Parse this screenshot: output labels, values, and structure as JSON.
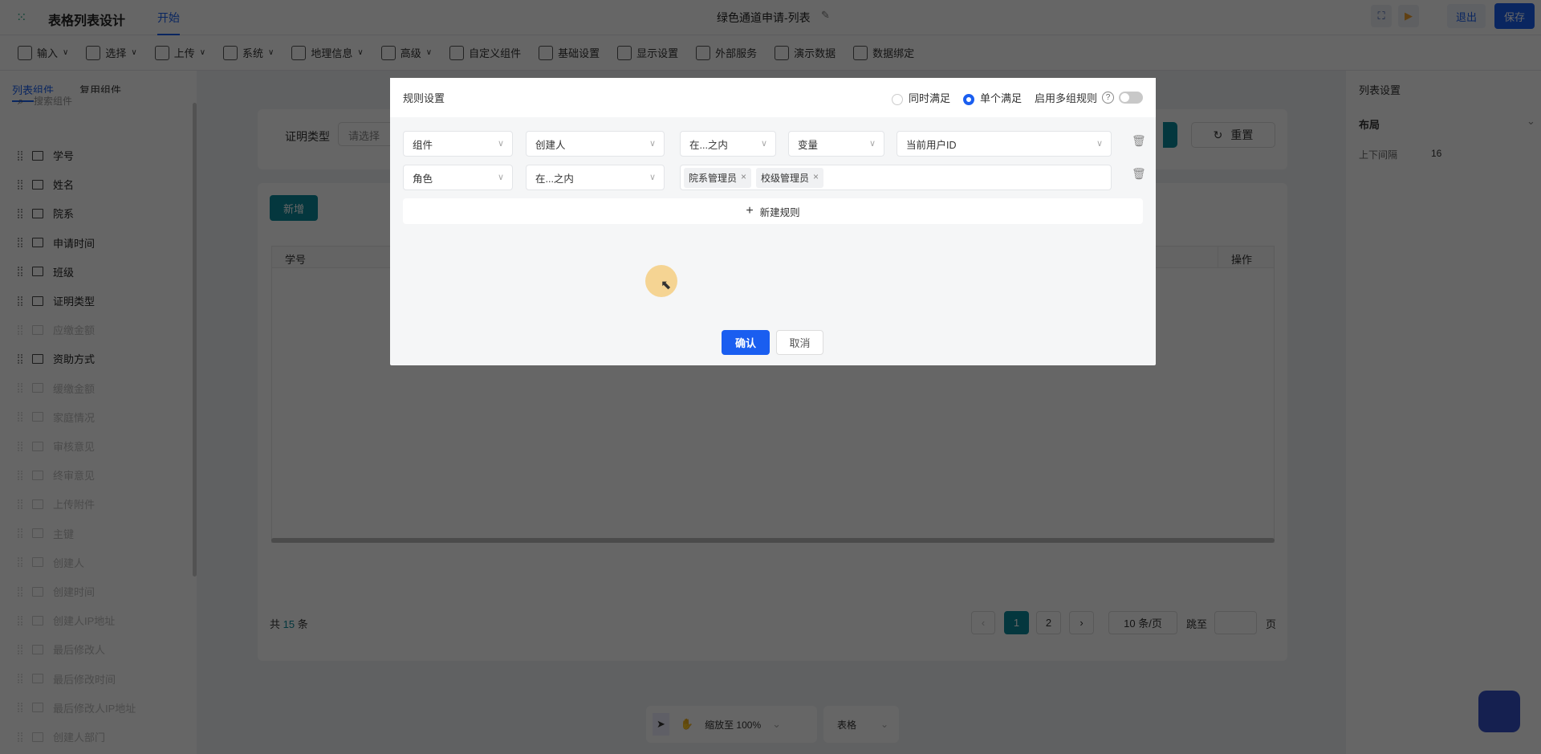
{
  "app": {
    "title": "表格列表设计",
    "tab": "开始",
    "doc_title": "绿色通道申请-列表",
    "exit": "退出",
    "save": "保存"
  },
  "toolbar": [
    "输入",
    "选择",
    "上传",
    "系统",
    "地理信息",
    "高级",
    "自定义组件",
    "基础设置",
    "显示设置",
    "外部服务",
    "演示数据",
    "数据绑定"
  ],
  "toolbar_dropdown": [
    true,
    true,
    true,
    true,
    true,
    true,
    false,
    false,
    false,
    false,
    false,
    false
  ],
  "left": {
    "tabs": [
      "列表组件",
      "复用组件"
    ],
    "search_placeholder": "搜索组件",
    "items": [
      {
        "label": "学号",
        "enabled": true
      },
      {
        "label": "姓名",
        "enabled": true
      },
      {
        "label": "院系",
        "enabled": true
      },
      {
        "label": "申请时间",
        "enabled": true
      },
      {
        "label": "班级",
        "enabled": true
      },
      {
        "label": "证明类型",
        "enabled": true
      },
      {
        "label": "应缴金额",
        "enabled": false
      },
      {
        "label": "资助方式",
        "enabled": true
      },
      {
        "label": "缓缴金额",
        "enabled": false
      },
      {
        "label": "家庭情况",
        "enabled": false
      },
      {
        "label": "审核意见",
        "enabled": false
      },
      {
        "label": "终审意见",
        "enabled": false
      },
      {
        "label": "上传附件",
        "enabled": false
      },
      {
        "label": "主键",
        "enabled": false
      },
      {
        "label": "创建人",
        "enabled": false
      },
      {
        "label": "创建时间",
        "enabled": false
      },
      {
        "label": "创建人IP地址",
        "enabled": false
      },
      {
        "label": "最后修改人",
        "enabled": false
      },
      {
        "label": "最后修改时间",
        "enabled": false
      },
      {
        "label": "最后修改人IP地址",
        "enabled": false
      },
      {
        "label": "创建人部门",
        "enabled": false
      }
    ]
  },
  "right": {
    "title": "列表设置",
    "section": "布局",
    "spacing_label": "上下间隔",
    "spacing_value": "16"
  },
  "canvas": {
    "filter_label": "证明类型",
    "filter_placeholder": "请选择",
    "reset": "重置",
    "add": "新增",
    "col_first": "学号",
    "col_last": "操作",
    "total_prefix": "共",
    "total": "15",
    "total_suffix": "条",
    "pages": [
      "1",
      "2"
    ],
    "page_size": "10 条/页",
    "jump": "跳至",
    "page_unit": "页"
  },
  "bottom": {
    "zoom": "缩放至 100%",
    "view": "表格"
  },
  "modal": {
    "title": "规则设置",
    "opt_all": "同时满足",
    "opt_single": "单个满足",
    "selected": "single",
    "multi": "启用多组规则",
    "multi_enabled": false,
    "row1": [
      "组件",
      "创建人",
      "在...之内",
      "变量",
      "当前用户ID"
    ],
    "row2": [
      "角色",
      "在...之内"
    ],
    "row2_tags": [
      "院系管理员",
      "校级管理员"
    ],
    "add_rule": "新建规则",
    "confirm": "确认",
    "cancel": "取消"
  },
  "colors": {
    "primary": "#1a5ef0",
    "teal": "#0b8a9a"
  }
}
